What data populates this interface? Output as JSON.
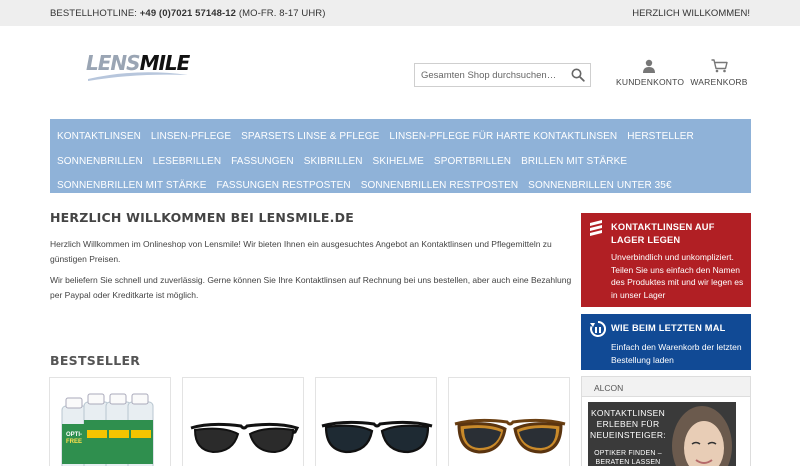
{
  "topbar": {
    "hotline_label": "BESTELLHOTLINE:",
    "hotline_number": "+49 (0)7021 57148-12",
    "hotline_hours": "(MO-FR. 8-17 UHR)",
    "welcome": "HERZLICH WILLKOMMEN!"
  },
  "logo": {
    "part1": "LENS",
    "part2": "MILE"
  },
  "search": {
    "placeholder": "Gesamten Shop durchsuchen…"
  },
  "header_links": {
    "account": "KUNDENKONTO",
    "cart": "WARENKORB"
  },
  "nav": {
    "items": [
      "KONTAKTLINSEN",
      "LINSEN-PFLEGE",
      "SPARSETS LINSE & PFLEGE",
      "LINSEN-PFLEGE FÜR HARTE KONTAKTLINSEN",
      "HERSTELLER",
      "SONNENBRILLEN",
      "LESEBRILLEN",
      "FASSUNGEN",
      "SKIBRILLEN",
      "SKIHELME",
      "SPORTBRILLEN",
      "BRILLEN MIT STÄRKE",
      "SONNENBRILLEN MIT STÄRKE",
      "FASSUNGEN RESTPOSTEN",
      "SONNENBRILLEN RESTPOSTEN",
      "SONNENBRILLEN UNTER 35€"
    ]
  },
  "main": {
    "title": "HERZLICH WILLKOMMEN BEI LENSMILE.DE",
    "p1": "Herzlich Willkommen im Onlineshop von Lensmile! Wir bieten Ihnen ein ausgesuchtes Angebot an Kontaktlinsen und Pflegemitteln zu günstigen Preisen.",
    "p2": "Wir beliefern Sie schnell und zuverlässig. Gerne können Sie Ihre Kontaktlinsen auf Rechnung bei uns bestellen, aber auch eine Bezahlung per Paypal oder Kreditkarte ist möglich."
  },
  "bestseller": {
    "title": "BESTSELLER"
  },
  "product_images": {
    "p1_text1": "OPTI-",
    "p1_text2": "FREE"
  },
  "sidebar": {
    "box1_title": "KONTAKTLINSEN AUF LAGER LEGEN",
    "box1_text": "Unverbindlich und unkompliziert. Teilen Sie uns einfach den Namen des Produktes mit und wir legen es in unser Lager",
    "box2_title": "WIE BEIM LETZTEN MAL",
    "box2_text": "Einfach den Warenkorb der letzten Bestellung laden",
    "alcon_label": "ALCON",
    "ad_line1": "KONTAKTLINSEN ERLEBEN FÜR NEUEINSTEIGER:",
    "ad_line2": "OPTIKER FINDEN – BERATEN LASSEN"
  },
  "colors": {
    "nav": "#8fb2d8",
    "red_box": "#b11f24",
    "blue_box": "#114a95",
    "topbar": "#eeeeee"
  }
}
